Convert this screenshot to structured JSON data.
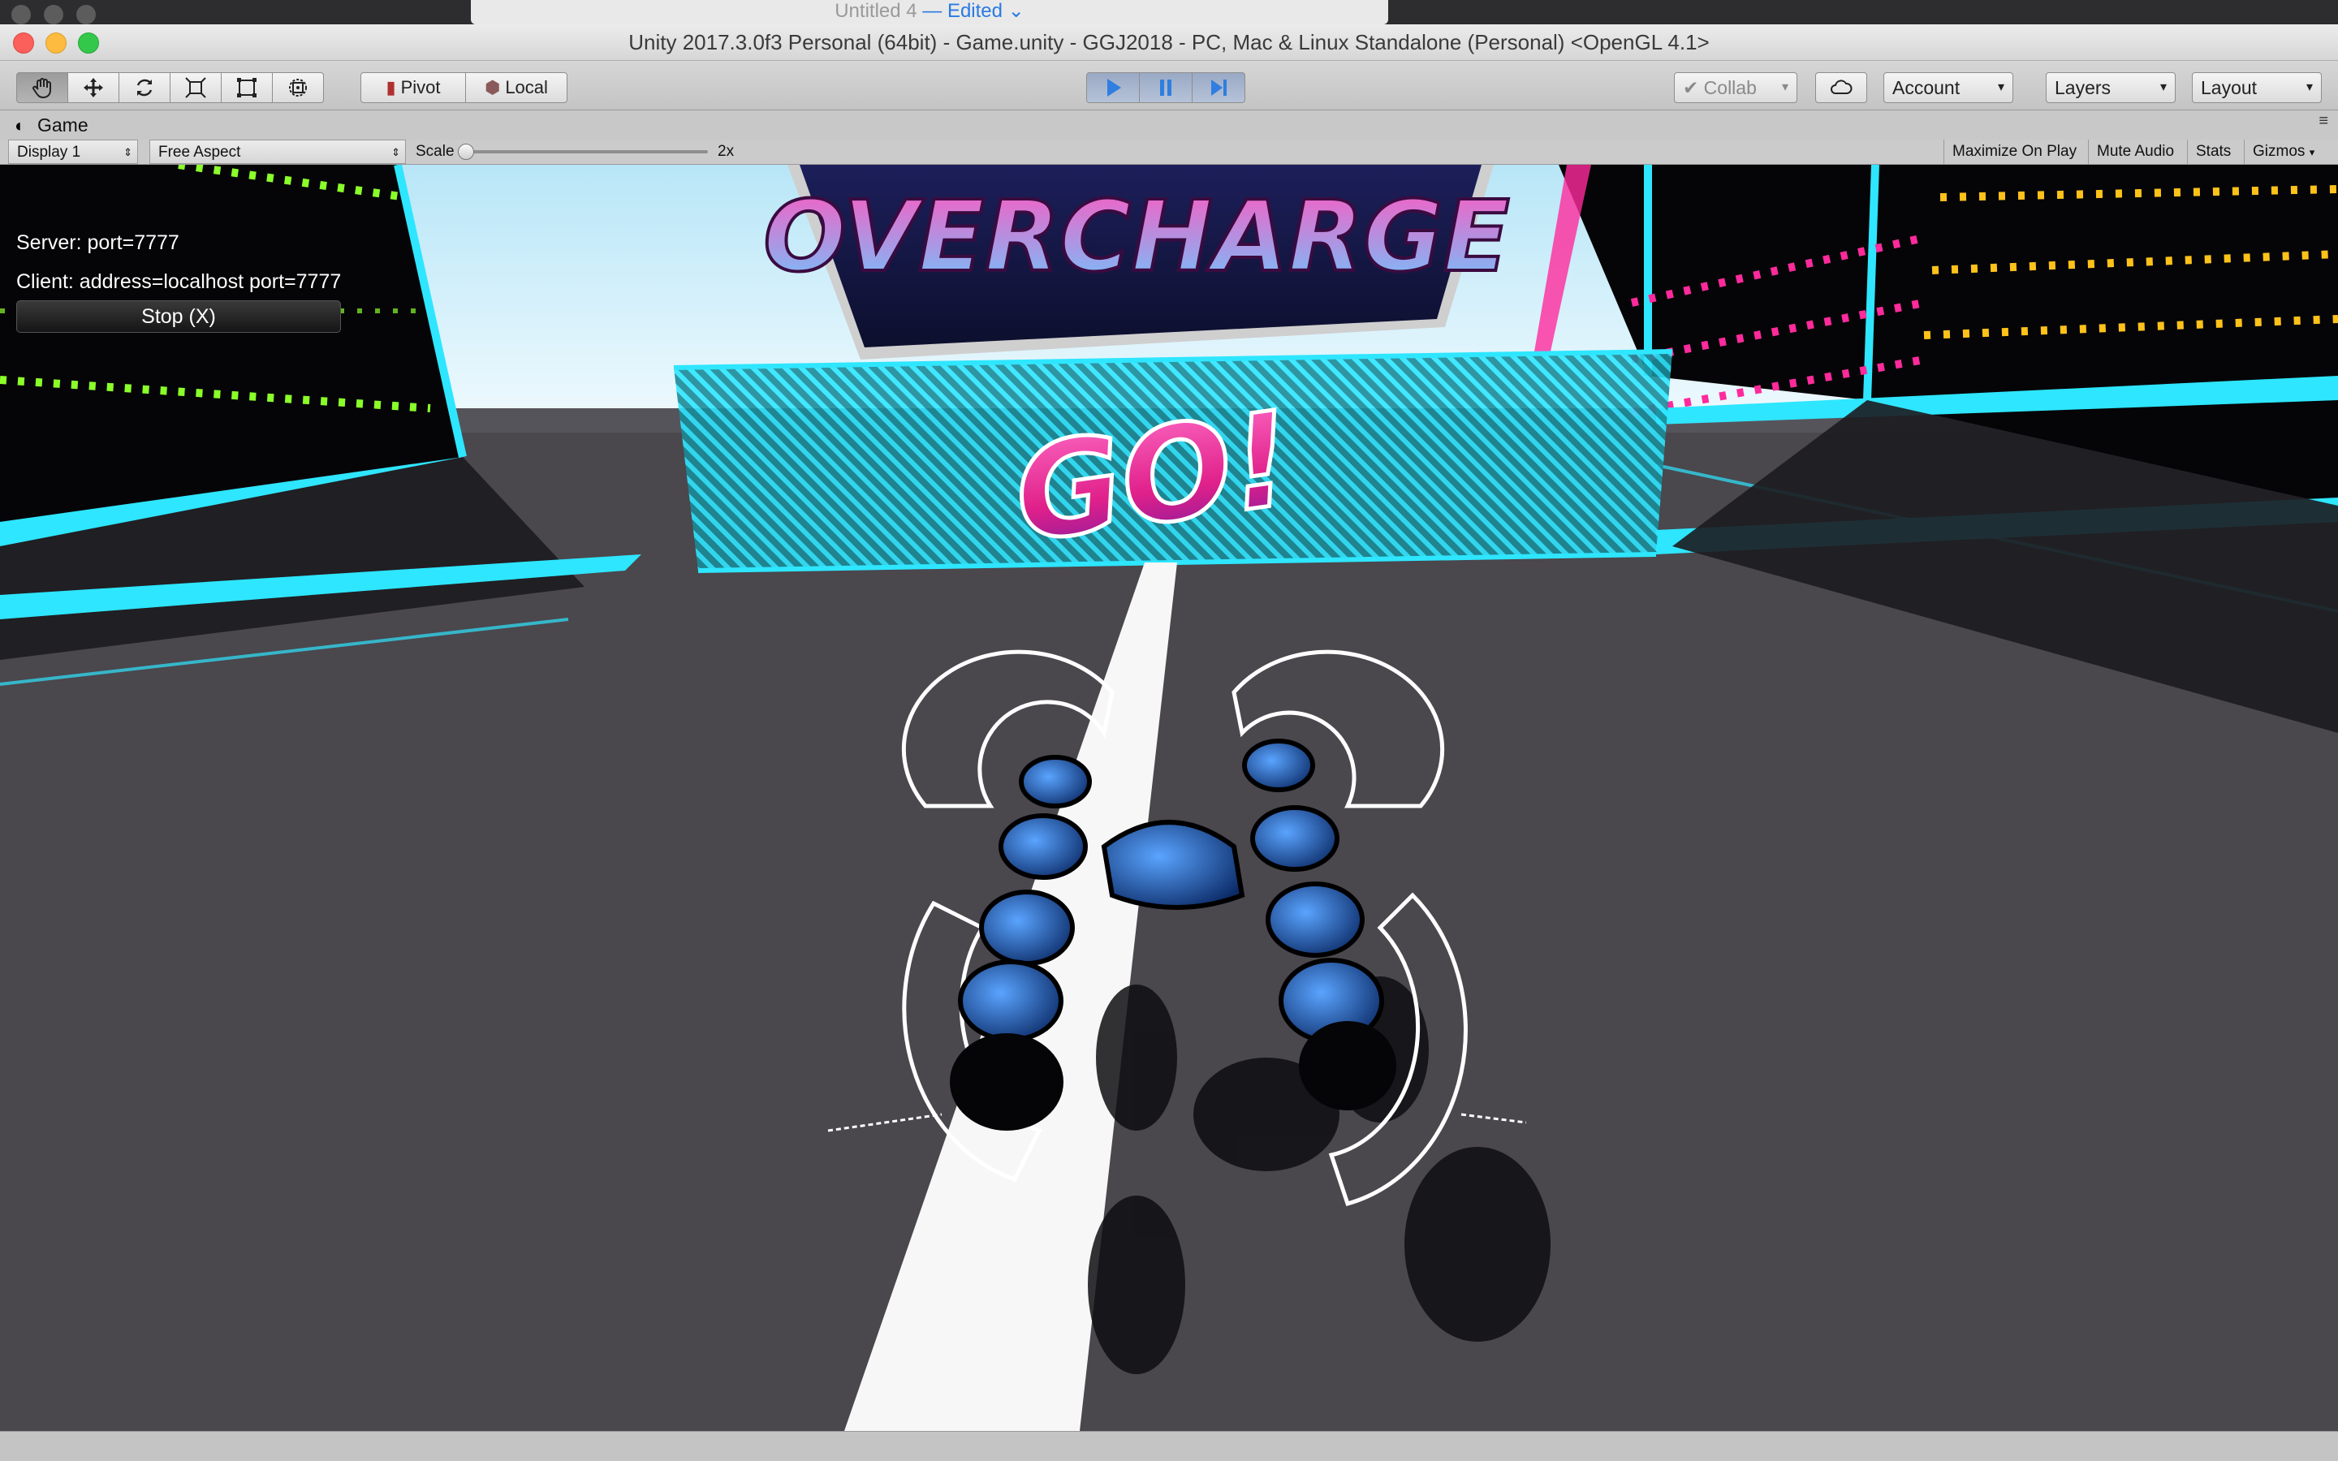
{
  "background_window": {
    "title": "Untitled 4",
    "state": "— Edited"
  },
  "window": {
    "title": "Unity 2017.3.0f3 Personal (64bit) - Game.unity - GGJ2018 - PC, Mac & Linux Standalone (Personal) <OpenGL 4.1>"
  },
  "toolbar": {
    "pivot_label": "Pivot",
    "local_label": "Local",
    "collab_label": "Collab",
    "account_label": "Account",
    "layers_label": "Layers",
    "layout_label": "Layout"
  },
  "game_tab": {
    "label": "Game"
  },
  "game_bar": {
    "display": "Display 1",
    "aspect": "Free Aspect",
    "scale_label": "Scale",
    "scale_value": "2x",
    "scale_fraction": 0.0,
    "maximize_label": "Maximize On Play",
    "mute_label": "Mute Audio",
    "stats_label": "Stats",
    "gizmos_label": "Gizmos"
  },
  "game_view": {
    "server_text": "Server: port=7777",
    "client_text": "Client: address=localhost port=7777",
    "stop_button": "Stop (X)",
    "banner_text": "OVERCHARGE",
    "go_text": "GO!"
  },
  "colors": {
    "neon_cyan": "#2ee6ff",
    "neon_pink": "#ff2a9c",
    "neon_green": "#8aff2a",
    "neon_yellow": "#ffc21a",
    "floor": "#4a474d",
    "sky": "#dff2fb",
    "play_active": "#4a90e2"
  },
  "icons": [
    "hand-icon",
    "move-icon",
    "rotate-icon",
    "scale-icon",
    "rect-icon",
    "transform-icon",
    "play-icon",
    "pause-icon",
    "step-icon",
    "cloud-icon",
    "game-icon"
  ]
}
